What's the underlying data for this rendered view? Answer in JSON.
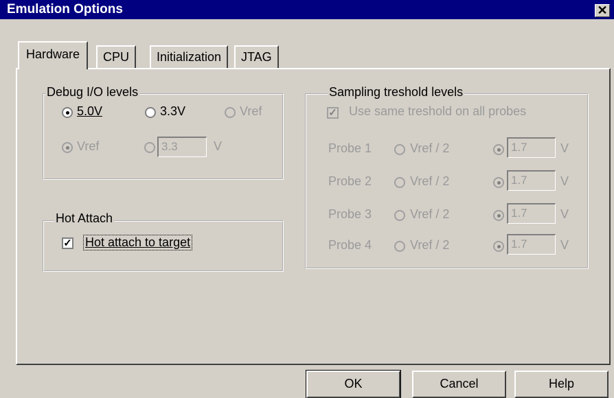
{
  "window": {
    "title": "Emulation Options",
    "close_glyph": "✕"
  },
  "tabs": [
    {
      "label": "Hardware",
      "active": true
    },
    {
      "label": "CPU",
      "active": false
    },
    {
      "label": "Initialization",
      "active": false
    },
    {
      "label": "JTAG",
      "active": false
    }
  ],
  "debug_io": {
    "legend": "Debug I/O levels",
    "options": [
      {
        "label": "5.0V",
        "selected": true,
        "enabled": true
      },
      {
        "label": "3.3V",
        "selected": false,
        "enabled": true
      },
      {
        "label": "Vref",
        "selected": false,
        "enabled": false
      }
    ],
    "vref_options": [
      {
        "label": "Vref",
        "selected": true,
        "enabled": false
      },
      {
        "label": "",
        "selected": false,
        "enabled": false
      }
    ],
    "custom_value": "3.3",
    "unit": "V"
  },
  "hot_attach": {
    "legend": "Hot Attach",
    "checkbox_label": "Hot attach to target",
    "checked": true
  },
  "sampling": {
    "legend": "Sampling treshold levels",
    "same_label": "Use same treshold on all probes",
    "same_checked": true,
    "probes": [
      {
        "label": "Probe 1",
        "vref_label": "Vref / 2",
        "value": "1.7",
        "unit": "V"
      },
      {
        "label": "Probe 2",
        "vref_label": "Vref / 2",
        "value": "1.7",
        "unit": "V"
      },
      {
        "label": "Probe 3",
        "vref_label": "Vref / 2",
        "value": "1.7",
        "unit": "V"
      },
      {
        "label": "Probe 4",
        "vref_label": "Vref / 2",
        "value": "1.7",
        "unit": "V"
      }
    ]
  },
  "buttons": {
    "ok": "OK",
    "cancel": "Cancel",
    "help": "Help"
  }
}
